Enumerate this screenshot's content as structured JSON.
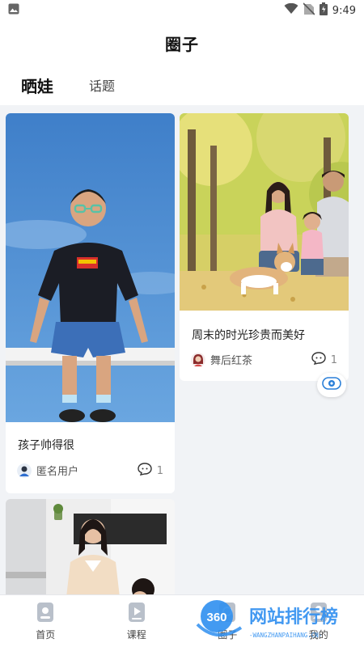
{
  "status": {
    "time": "9:49"
  },
  "header": {
    "title": "圈子"
  },
  "tabs": [
    {
      "label": "晒娃",
      "active": true
    },
    {
      "label": "话题",
      "active": false
    }
  ],
  "posts": [
    {
      "title": "孩子帅得很",
      "author": "匿名用户",
      "comments": "1",
      "image": "boy-sitting-on-rail-photo"
    },
    {
      "title": "周末的时光珍贵而美好",
      "author": "舞后红茶",
      "comments": "1",
      "image": "family-with-dog-photo"
    },
    {
      "title": "",
      "author": "",
      "comments": "",
      "image": "woman-in-kitchen-photo"
    }
  ],
  "bottom_nav": [
    {
      "label": "首页",
      "icon": "home-icon"
    },
    {
      "label": "课程",
      "icon": "course-play-icon"
    },
    {
      "label": "圈子",
      "icon": "circle-icon"
    },
    {
      "label": "我的",
      "icon": "profile-icon"
    }
  ],
  "watermark": {
    "badge": "360",
    "text": "网站排行榜",
    "subtext": "-WANGZHANPAIHANG.CN-"
  },
  "colors": {
    "feed_bg": "#f1f3f6",
    "watermark_blue": "#2f8ff0"
  }
}
